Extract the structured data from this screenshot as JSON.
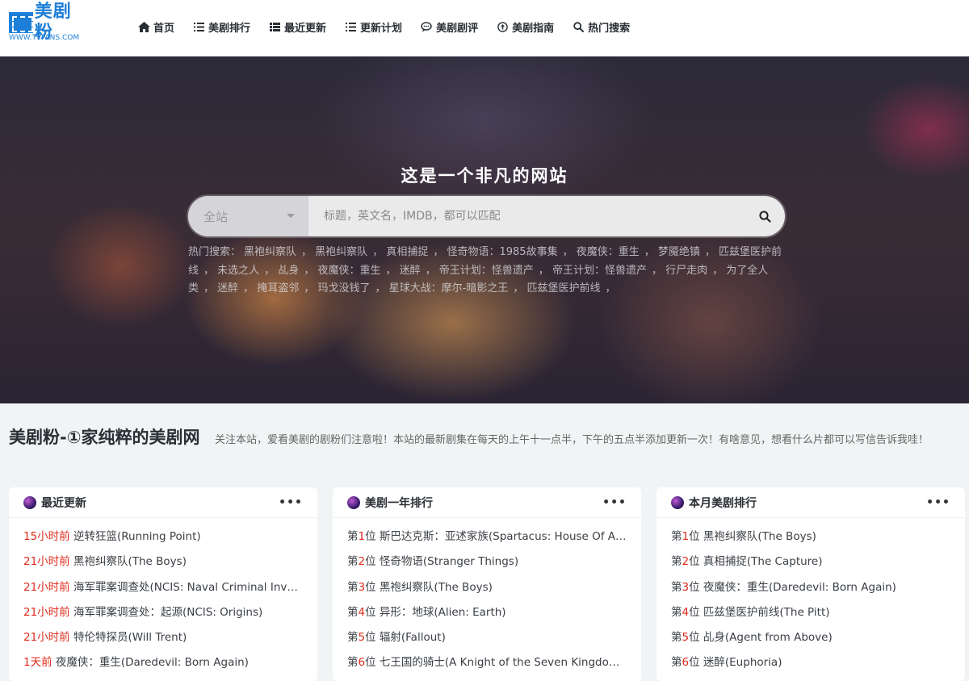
{
  "logo": {
    "text": "美剧粉",
    "subtext": "WWW.TVFANS.COM"
  },
  "nav": [
    {
      "label": "首页",
      "icon": "home-icon"
    },
    {
      "label": "美剧排行",
      "icon": "list-icon"
    },
    {
      "label": "最近更新",
      "icon": "th-list-icon"
    },
    {
      "label": "更新计划",
      "icon": "list-icon"
    },
    {
      "label": "美剧剧评",
      "icon": "comment-icon"
    },
    {
      "label": "美剧指南",
      "icon": "arrow-up-circle-icon"
    },
    {
      "label": "热门搜索",
      "icon": "search-icon"
    }
  ],
  "hero": {
    "title": "这是一个非凡的网站",
    "scope": "全站",
    "placeholder": "标题，英文名，IMDB，都可以匹配",
    "hot_label": "热门搜索：",
    "hot_keywords": [
      "黑袍纠察队",
      "黑袍纠察队",
      "真相捕捉",
      "怪奇物语：1985故事集",
      "夜魔侠：重生",
      "梦魇绝镇",
      "匹兹堡医护前线",
      "未选之人",
      "乩身",
      "夜魔侠：重生",
      "迷醉",
      "帝王计划：怪兽遗产",
      "帝王计划：怪兽遗产",
      "行尸走肉",
      "为了全人类",
      "迷醉",
      "掩耳盗邻",
      "玛戈没钱了",
      "星球大战：摩尔-暗影之王",
      "匹兹堡医护前线"
    ]
  },
  "about": {
    "title": "美剧粉-①家纯粹的美剧网",
    "desc": "关注本站，爱看美剧的剧粉们注意啦！本站的最新剧集在每天的上午十一点半，下午的五点半添加更新一次！有啥意见，想看什么片都可以写信告诉我哇！"
  },
  "cards": [
    {
      "title": "最近更新",
      "more": "•••",
      "items": [
        {
          "prefix": "15小时前",
          "text": "逆转狂篮(Running Point)"
        },
        {
          "prefix": "21小时前",
          "text": "黑袍纠察队(The Boys)"
        },
        {
          "prefix": "21小时前",
          "text": "海军罪案调查处(NCIS: Naval Criminal Investigative Service)"
        },
        {
          "prefix": "21小时前",
          "text": "海军罪案调查处：起源(NCIS: Origins)"
        },
        {
          "prefix": "21小时前",
          "text": "特伦特探员(Will Trent)"
        },
        {
          "prefix": "1天前",
          "text": "夜魔侠：重生(Daredevil: Born Again)"
        }
      ]
    },
    {
      "title": "美剧一年排行",
      "more": "•••",
      "items": [
        {
          "pre": "第",
          "num": "1",
          "post": "位",
          "text": "斯巴达克斯：亚述家族(Spartacus: House Of Ashur)"
        },
        {
          "pre": "第",
          "num": "2",
          "post": "位",
          "text": "怪奇物语(Stranger Things)"
        },
        {
          "pre": "第",
          "num": "3",
          "post": "位",
          "text": "黑袍纠察队(The Boys)"
        },
        {
          "pre": "第",
          "num": "4",
          "post": "位",
          "text": "异形：地球(Alien: Earth)"
        },
        {
          "pre": "第",
          "num": "5",
          "post": "位",
          "text": "辐射(Fallout)"
        },
        {
          "pre": "第",
          "num": "6",
          "post": "位",
          "text": "七王国的骑士(A Knight of the Seven Kingdoms)"
        }
      ]
    },
    {
      "title": "本月美剧排行",
      "more": "•••",
      "items": [
        {
          "pre": "第",
          "num": "1",
          "post": "位",
          "text": "黑袍纠察队(The Boys)"
        },
        {
          "pre": "第",
          "num": "2",
          "post": "位",
          "text": "真相捕捉(The Capture)"
        },
        {
          "pre": "第",
          "num": "3",
          "post": "位",
          "text": "夜魔侠：重生(Daredevil: Born Again)"
        },
        {
          "pre": "第",
          "num": "4",
          "post": "位",
          "text": "匹兹堡医护前线(The Pitt)"
        },
        {
          "pre": "第",
          "num": "5",
          "post": "位",
          "text": "乩身(Agent from Above)"
        },
        {
          "pre": "第",
          "num": "6",
          "post": "位",
          "text": "迷醉(Euphoria)"
        }
      ]
    }
  ],
  "colors": {
    "accent": "#e02b1b",
    "brand": "#1e7fd8"
  }
}
